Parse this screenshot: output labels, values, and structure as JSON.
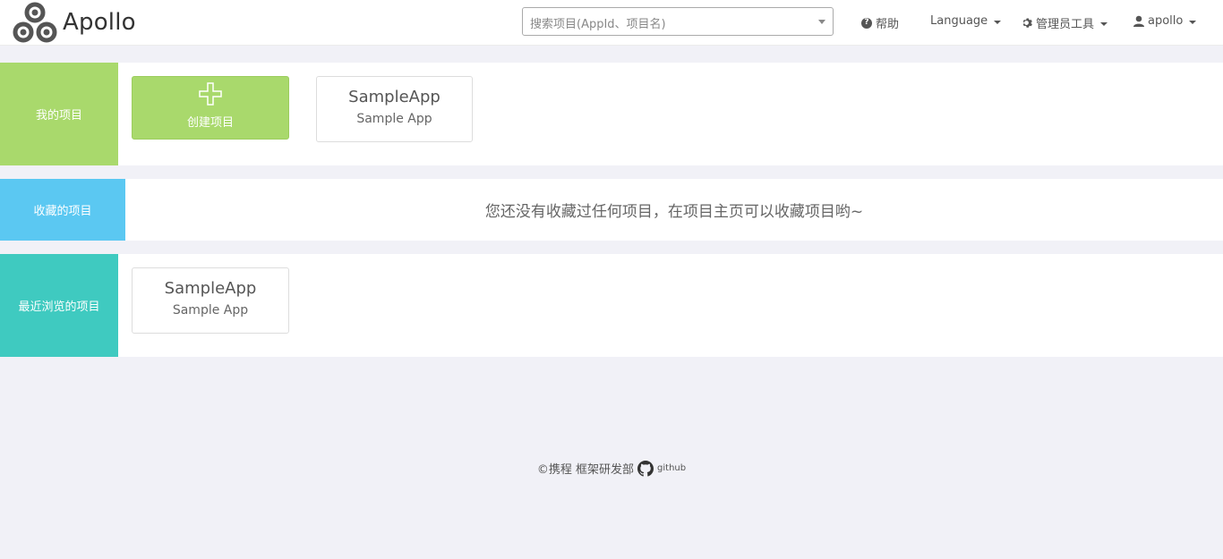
{
  "app": {
    "logo_text": "Apollo"
  },
  "navbar": {
    "search_placeholder": "搜索项目(AppId、项目名)",
    "help_label": "帮助",
    "language_label": "Language",
    "admin_tools_label": "管理员工具",
    "user_label": "apollo",
    "icons": {
      "help": "question-circle-icon",
      "admin": "gear-icon",
      "user": "user-icon",
      "search_dropdown": "caret-down-icon"
    }
  },
  "my_projects": {
    "label": "我的项目",
    "create_label": "创建项目",
    "apps": [
      {
        "app_id": "SampleApp",
        "name": "Sample App"
      }
    ],
    "color": "#a9d96c"
  },
  "favorite_projects": {
    "label": "收藏的项目",
    "empty_message": "您还没有收藏过任何项目，在项目主页可以收藏项目哟~",
    "color": "#5bc8f2"
  },
  "recent_projects": {
    "label": "最近浏览的项目",
    "apps": [
      {
        "app_id": "SampleApp",
        "name": "Sample App"
      }
    ],
    "color": "#3fcac0"
  },
  "footer": {
    "copyright": "©携程 框架研发部",
    "github_label": "github"
  }
}
